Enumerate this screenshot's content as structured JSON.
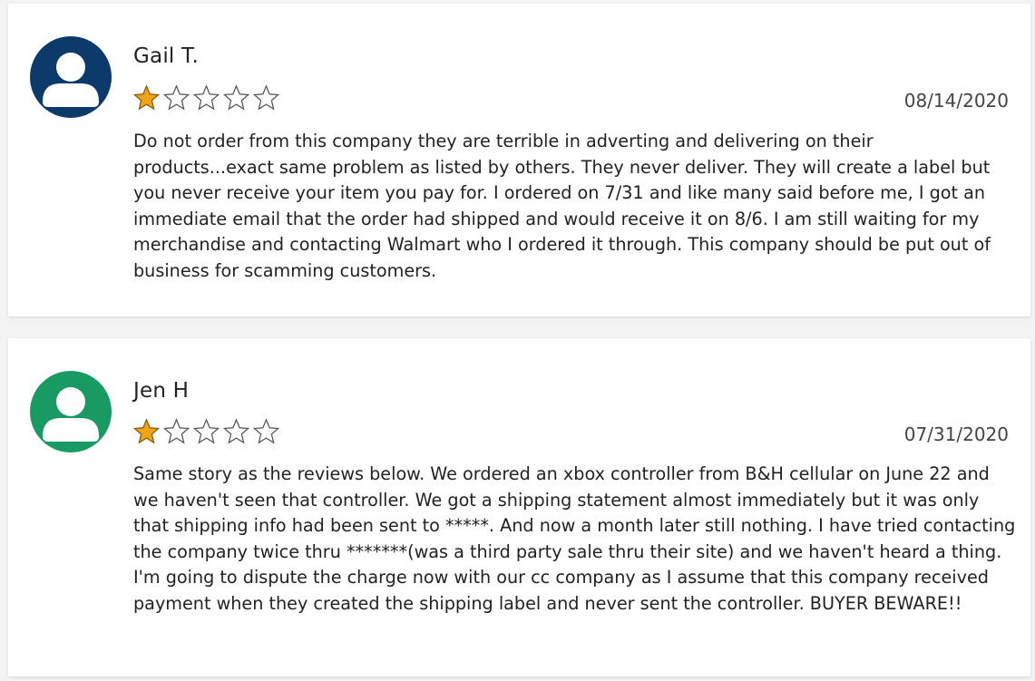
{
  "colors": {
    "avatar_1": "#0b3a6b",
    "avatar_2": "#1a9a63",
    "star_filled": "#f0a31a",
    "star_empty_stroke": "#555555"
  },
  "reviews": [
    {
      "reviewer": "Gail T.",
      "avatar_icon": "user-avatar-icon",
      "rating": 1,
      "rating_max": 5,
      "date": "08/14/2020",
      "text": "Do not order from this company they are terrible in adverting and delivering on their products...exact same problem as listed by others. They never deliver. They will create a label but you never receive your item you pay for. I ordered on 7/31 and like many said before me, I got an immediate email that the order had shipped and would receive it on 8/6. I am still waiting for my merchandise and contacting Walmart who I ordered it through. This company should be put out of business for scamming customers."
    },
    {
      "reviewer": "Jen H",
      "avatar_icon": "user-avatar-icon",
      "rating": 1,
      "rating_max": 5,
      "date": "07/31/2020",
      "text": "Same story as the reviews below. We ordered an xbox controller from B&H cellular on June 22 and we haven't seen that controller. We got a shipping statement almost immediately but it was only that shipping info had been sent to *****. And now a month later still nothing. I have tried contacting the company twice thru *******(was a third party sale thru their site) and we haven't heard a thing. I'm going to dispute the charge now with our cc company as I assume that this company received payment when they created the shipping label and never sent the controller. BUYER BEWARE!!"
    }
  ]
}
